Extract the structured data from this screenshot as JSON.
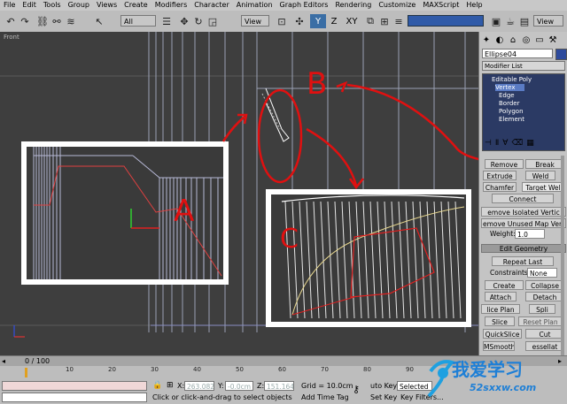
{
  "menu": [
    "File",
    "Edit",
    "Tools",
    "Group",
    "Views",
    "Create",
    "Modifiers",
    "Character",
    "Animation",
    "Graph Editors",
    "Rendering",
    "Customize",
    "MAXScript",
    "Help"
  ],
  "toolbar": {
    "selection_filter": "All",
    "ref_coord": "View",
    "axis_x": "X",
    "axis_y": "Y",
    "axis_z": "Z",
    "axis_xy": "XY",
    "view_dropdown": "View"
  },
  "viewport": {
    "label": "Front",
    "annotations": {
      "a": "A",
      "b": "B",
      "c": "C"
    }
  },
  "command_panel": {
    "object_name": "Ellipse04",
    "modifier_list": "Modifier List",
    "stack": [
      "Editable Poly",
      "Vertex",
      "Edge",
      "Border",
      "Polygon",
      "Element"
    ],
    "buttons": {
      "remove": "Remove",
      "break": "Break",
      "extrude": "Extrude",
      "weld": "Weld",
      "chamfer": "Chamfer",
      "target_weld": "Target Wel",
      "connect": "Connect",
      "remove_isolated": "emove Isolated Vertic",
      "remove_unused": "emove Unused Map Vert",
      "weight_label": "Weight:",
      "weight_value": "1.0",
      "edit_geometry": "Edit Geometry",
      "repeat_last": "Repeat Last",
      "constraints_label": "Constraints:",
      "constraints_value": "None",
      "create": "Create",
      "collapse": "Collapse",
      "attach": "Attach",
      "detach": "Detach",
      "slice_plane": "lice Plan",
      "split": "Spli",
      "slice": "Slice",
      "reset_plane": "Reset Plan",
      "quickslice": "QuickSlice",
      "cut": "Cut",
      "msmooth": "MSmooth",
      "tessellate": "essellat"
    }
  },
  "timeline": {
    "frame_label": "0 / 100",
    "ticks": [
      "10",
      "20",
      "30",
      "40",
      "50",
      "60",
      "70",
      "80",
      "90"
    ]
  },
  "status": {
    "x_label": "X:",
    "x_value": "263.082",
    "y_label": "Y:",
    "y_value": "-0.0cm",
    "z_label": "Z:",
    "z_value": "151.164",
    "grid": "Grid = 10.0cm",
    "prompt": "Click or click-and-drag to select objects",
    "add_time_tag": "Add Time Tag",
    "auto_key": "uto Key",
    "selected": "Selected",
    "set_key": "Set Key",
    "key_filters": "Key Filters..."
  },
  "watermark": {
    "text": "我爱学习",
    "url": "52sxxw.com"
  },
  "colors": {
    "viewport_bg": "#3e3e3e",
    "annotation_red": "#e01010",
    "active_axis": "#3a6ea5"
  }
}
